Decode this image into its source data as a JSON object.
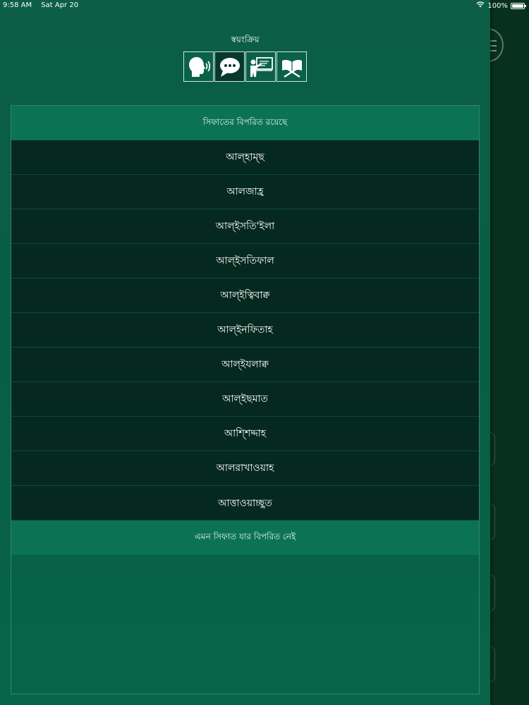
{
  "status_bar": {
    "time": "9:58 AM",
    "date": "Sat Apr 20",
    "battery": "100%",
    "battery_level": 1.0
  },
  "mode": {
    "title": "স্বয়ংক্রিয়",
    "buttons": [
      {
        "icon": "speaking-head-icon",
        "active": false
      },
      {
        "icon": "chat-bubble-icon",
        "active": true
      },
      {
        "icon": "teacher-board-icon",
        "active": false
      },
      {
        "icon": "quran-book-icon",
        "active": false
      }
    ]
  },
  "sections": [
    {
      "header": "সিফাতের বিপরিত রয়েছে",
      "items": [
        "আল্হাম্ছ",
        "আলজাহ্র",
        "আল্ইসতি'ইলা",
        "আল্ইসতিফাল",
        "আল্ইত্বিবাক্ব",
        "আল্ইনফিতাহ",
        "আল্ইযলাক্ব",
        "আল্ইছমাত",
        "আশ্শিদ্দাহ",
        "আলরাখাওয়াহ",
        "আত্তাওয়াচ্ছুত"
      ]
    },
    {
      "header": "এমন সিফাত যার বিপরিত নেই",
      "items": []
    }
  ],
  "colors": {
    "panel": "#075e44",
    "header": "#0b7354",
    "row": "#06291f",
    "text": "#ffffff"
  }
}
